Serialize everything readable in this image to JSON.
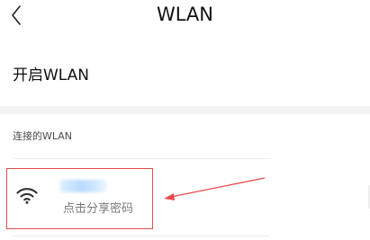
{
  "header": {
    "title": "WLAN",
    "back_icon": "chevron-left-icon"
  },
  "wlan_toggle": {
    "label": "开启WLAN"
  },
  "connected_section": {
    "header": "连接的WLAN",
    "network": {
      "icon": "wifi-icon",
      "action_label": "点击分享密码"
    }
  },
  "annotation": {
    "color": "#e84b4b"
  }
}
